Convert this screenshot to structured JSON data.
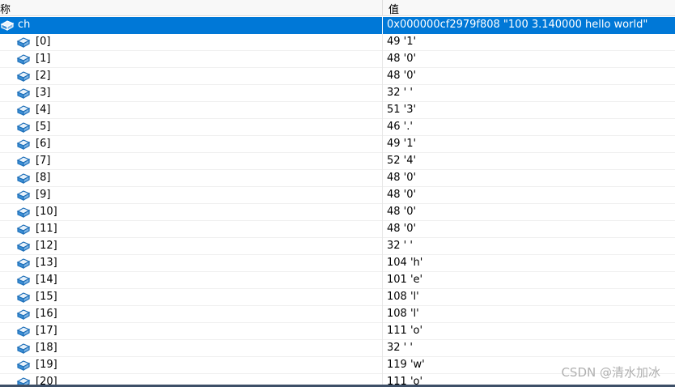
{
  "header": {
    "name_col": "称",
    "value_col": "值"
  },
  "root": {
    "name": "ch",
    "value": "0x000000cf2979f808 \"100 3.140000 hello world\""
  },
  "items": [
    {
      "name": "[0]",
      "value": "49 '1'"
    },
    {
      "name": "[1]",
      "value": "48 '0'"
    },
    {
      "name": "[2]",
      "value": "48 '0'"
    },
    {
      "name": "[3]",
      "value": "32 ' '"
    },
    {
      "name": "[4]",
      "value": "51 '3'"
    },
    {
      "name": "[5]",
      "value": "46 '.'"
    },
    {
      "name": "[6]",
      "value": "49 '1'"
    },
    {
      "name": "[7]",
      "value": "52 '4'"
    },
    {
      "name": "[8]",
      "value": "48 '0'"
    },
    {
      "name": "[9]",
      "value": "48 '0'"
    },
    {
      "name": "[10]",
      "value": "48 '0'"
    },
    {
      "name": "[11]",
      "value": "48 '0'"
    },
    {
      "name": "[12]",
      "value": "32 ' '"
    },
    {
      "name": "[13]",
      "value": "104 'h'"
    },
    {
      "name": "[14]",
      "value": "101 'e'"
    },
    {
      "name": "[15]",
      "value": "108 'l'"
    },
    {
      "name": "[16]",
      "value": "108 'l'"
    },
    {
      "name": "[17]",
      "value": "111 'o'"
    },
    {
      "name": "[18]",
      "value": "32 ' '"
    },
    {
      "name": "[19]",
      "value": "119 'w'"
    },
    {
      "name": "[20]",
      "value": "111 'o'"
    }
  ],
  "watermark": "CSDN @清水加冰",
  "icon": "variable-cube-icon"
}
